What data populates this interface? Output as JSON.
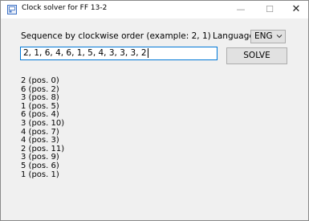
{
  "window": {
    "title": "Clock solver for FF 13-2",
    "minimize_glyph": "—",
    "maximize_glyph": "☐",
    "close_glyph": "✕"
  },
  "form": {
    "instruction": "Sequence by clockwise order (example: 2, 1)",
    "language_label": "Language",
    "language_value": "ENG",
    "sequence_value": "2, 1, 6, 4, 6, 1, 5, 4, 3, 3, 3, 2",
    "solve_label": "SOLVE"
  },
  "results": [
    "2 (pos. 0)",
    "6 (pos. 2)",
    "3 (pos. 8)",
    "1 (pos. 5)",
    "6 (pos. 4)",
    "3 (pos. 10)",
    "4 (pos. 7)",
    "4 (pos. 3)",
    "2 (pos. 11)",
    "3 (pos. 9)",
    "5 (pos. 6)",
    "1 (pos. 1)"
  ],
  "colors": {
    "window_bg": "#f0f0f0",
    "titlebar_bg": "#ffffff",
    "input_focus_border": "#0078d7",
    "button_bg": "#e1e1e1",
    "button_border": "#adadad"
  },
  "icons": {
    "app": "clock-app-icon",
    "dropdown": "chevron-down-icon"
  }
}
